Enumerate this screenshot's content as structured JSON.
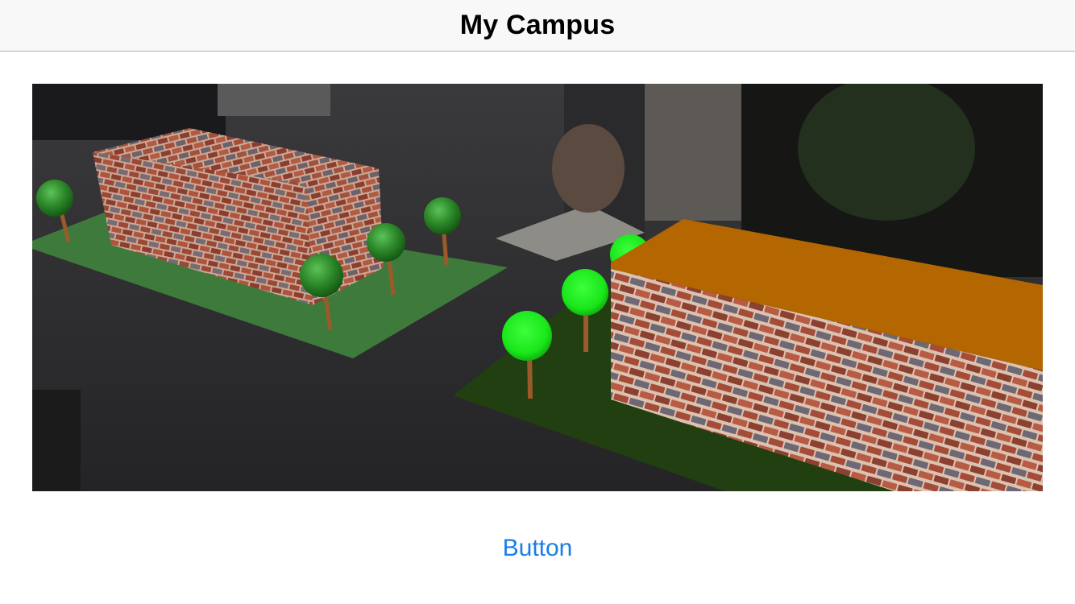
{
  "navigation": {
    "title": "My Campus"
  },
  "ar_scene": {
    "description_icon": "ar-campus-scene",
    "ground_color": "#2d2d2f",
    "lawn_left_color": "#3f7a3d",
    "lawn_right_color": "#213f10",
    "roof_color": "#b46600",
    "tree_left_color": "#2e8a2a",
    "tree_right_color": "#19e619",
    "trunk_color": "#9a5a2a"
  },
  "button": {
    "label": "Button",
    "color": "#1a7fe6"
  }
}
